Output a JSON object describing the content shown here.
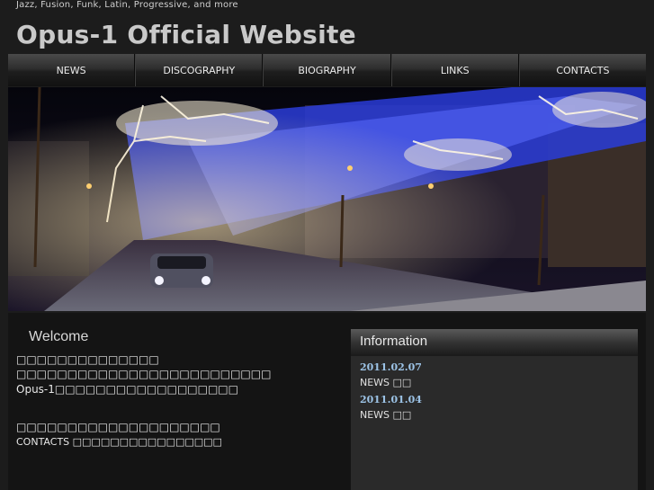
{
  "header": {
    "tagline": "Jazz, Fusion, Funk, Latin, Progressive, and more",
    "title": "Opus-1 Official Website"
  },
  "nav": {
    "items": [
      "NEWS",
      "DISCOGRAPHY",
      "BIOGRAPHY",
      "LINKS",
      "CONTACTS"
    ]
  },
  "welcome": {
    "heading": "Welcome",
    "line1": "□□□□□□□□□□□□□□",
    "line2": "□□□□□□□□□□□□□□□□□□□□□□□□□",
    "line3": "Opus-1□□□□□□□□□□□□□□□□□□",
    "line4": "□□□□□□□□□□□□□□□□□□□□",
    "line5": "CONTACTS □□□□□□□□□□□□□□□□"
  },
  "information": {
    "heading": "Information",
    "entries": [
      {
        "date": "2011.02.07",
        "text": "NEWS □□"
      },
      {
        "date": "2011.01.04",
        "text": "NEWS □□"
      }
    ]
  }
}
